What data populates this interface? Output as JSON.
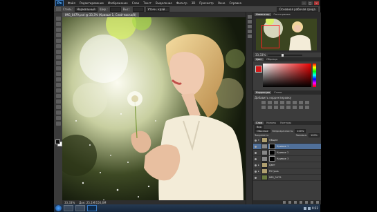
{
  "app": {
    "logo": "Ps"
  },
  "menu": [
    "Файл",
    "Редактирование",
    "Изображение",
    "Слои",
    "Текст",
    "Выделение",
    "Фильтр",
    "3D",
    "Просмотр",
    "Окно",
    "Справка"
  ],
  "options": {
    "style_label": "Стиль:",
    "style_value": "Нормальный",
    "width_label": "Шир.:",
    "height_label": "Выс.:",
    "refine_button": "Уточн. край...",
    "workspace": "Основная рабочая среда"
  },
  "document": {
    "tab_title": "IMG_0479.psd @ 33,3% (Кривые 1, Слой-маска/8)",
    "zoom": "33,33%",
    "doc_size": "Док: 25,1M/150,6M"
  },
  "panels": {
    "navigator_tabs": [
      "Навигатор",
      "Гистограмма"
    ],
    "nav_zoom": "33,33%",
    "color_tabs": [
      "Цвет",
      "Образцы"
    ],
    "adjust_tabs": [
      "Коррекция",
      "Стили"
    ],
    "adjust_title": "Добавить корректировку",
    "layers_tabs": [
      "Слои",
      "Каналы",
      "Контуры"
    ],
    "kind_label": "Вид",
    "blend_mode": "Обычные",
    "opacity_label": "Непрозрачность:",
    "opacity_value": "100%",
    "lock_label": "Закрепить:",
    "fill_label": "Заливка:",
    "fill_value": "100%"
  },
  "layers": [
    {
      "name": "Общее",
      "type": "group",
      "selected": false
    },
    {
      "name": "Кривые 1",
      "type": "adjustment",
      "selected": true
    },
    {
      "name": "Кривые 2",
      "type": "adjustment",
      "selected": false
    },
    {
      "name": "Кривые 3",
      "type": "adjustment",
      "selected": false
    },
    {
      "name": "Цвет",
      "type": "group",
      "selected": false
    },
    {
      "name": "Ретушь",
      "type": "group",
      "selected": false
    },
    {
      "name": "IMG_0479",
      "type": "pixel",
      "selected": false
    }
  ],
  "colors": {
    "foreground": "#d31919",
    "selection": "#50709a",
    "accent": "#3a7ac0"
  },
  "taskbar": {
    "clock": "0:22"
  }
}
